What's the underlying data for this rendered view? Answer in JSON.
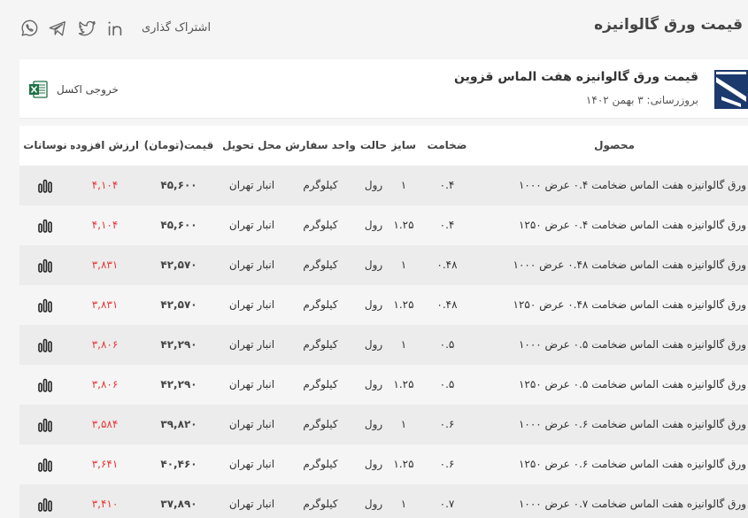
{
  "header": {
    "title": "قیمت ورق گالوانیزه",
    "share_label": "اشتراک گذاری"
  },
  "social_icons": [
    "linkedin-icon",
    "twitter-icon",
    "telegram-icon",
    "whatsapp-icon"
  ],
  "card": {
    "product_title": "قیمت ورق گالوانیزه هفت الماس قزوین",
    "update_text": "بروزرسانی: ۳ بهمن ۱۴۰۲",
    "excel_label": "خروجی اکسل"
  },
  "table": {
    "columns": {
      "product": "محصول",
      "thickness": "ضخامت",
      "size": "سایز",
      "state": "حالت",
      "unit": "واحد سفارش",
      "place": "محل تحویل",
      "price": "قیمت(تومان)",
      "vat": "ارزش افزوده",
      "trend": "نوسانات"
    },
    "rows": [
      {
        "product": "ورق گالوانیزه هفت الماس ضخامت ۰.۴ عرض ۱۰۰۰",
        "thickness": "۰.۴",
        "size": "۱",
        "state": "رول",
        "unit": "کیلوگرم",
        "place": "انبار تهران",
        "price": "۴۵,۶۰۰",
        "vat": "۴,۱۰۴"
      },
      {
        "product": "ورق گالوانیزه هفت الماس ضخامت ۰.۴ عرض ۱۲۵۰",
        "thickness": "۰.۴",
        "size": "۱.۲۵",
        "state": "رول",
        "unit": "کیلوگرم",
        "place": "انبار تهران",
        "price": "۴۵,۶۰۰",
        "vat": "۴,۱۰۴"
      },
      {
        "product": "ورق گالوانیزه هفت الماس ضخامت ۰.۴۸ عرض ۱۰۰۰",
        "thickness": "۰.۴۸",
        "size": "۱",
        "state": "رول",
        "unit": "کیلوگرم",
        "place": "انبار تهران",
        "price": "۴۲,۵۷۰",
        "vat": "۳,۸۳۱"
      },
      {
        "product": "ورق گالوانیزه هفت الماس ضخامت ۰.۴۸ عرض ۱۲۵۰",
        "thickness": "۰.۴۸",
        "size": "۱.۲۵",
        "state": "رول",
        "unit": "کیلوگرم",
        "place": "انبار تهران",
        "price": "۴۲,۵۷۰",
        "vat": "۳,۸۳۱"
      },
      {
        "product": "ورق گالوانیزه هفت الماس ضخامت ۰.۵ عرض ۱۰۰۰",
        "thickness": "۰.۵",
        "size": "۱",
        "state": "رول",
        "unit": "کیلوگرم",
        "place": "انبار تهران",
        "price": "۴۲,۲۹۰",
        "vat": "۳,۸۰۶"
      },
      {
        "product": "ورق گالوانیزه هفت الماس ضخامت ۰.۵ عرض ۱۲۵۰",
        "thickness": "۰.۵",
        "size": "۱.۲۵",
        "state": "رول",
        "unit": "کیلوگرم",
        "place": "انبار تهران",
        "price": "۴۲,۲۹۰",
        "vat": "۳,۸۰۶"
      },
      {
        "product": "ورق گالوانیزه هفت الماس ضخامت ۰.۶ عرض ۱۰۰۰",
        "thickness": "۰.۶",
        "size": "۱",
        "state": "رول",
        "unit": "کیلوگرم",
        "place": "انبار تهران",
        "price": "۳۹,۸۲۰",
        "vat": "۳,۵۸۴"
      },
      {
        "product": "ورق گالوانیزه هفت الماس ضخامت ۰.۶ عرض ۱۲۵۰",
        "thickness": "۰.۶",
        "size": "۱.۲۵",
        "state": "رول",
        "unit": "کیلوگرم",
        "place": "انبار تهران",
        "price": "۴۰,۴۶۰",
        "vat": "۳,۶۴۱"
      },
      {
        "product": "ورق گالوانیزه هفت الماس ضخامت ۰.۷ عرض ۱۰۰۰",
        "thickness": "۰.۷",
        "size": "۱",
        "state": "رول",
        "unit": "کیلوگرم",
        "place": "انبار تهران",
        "price": "۳۷,۸۹۰",
        "vat": "۳,۴۱۰"
      }
    ]
  },
  "colors": {
    "vat_red": "#e53935",
    "logo_blue": "#1d3a6e",
    "excel_green": "#1e7145"
  }
}
